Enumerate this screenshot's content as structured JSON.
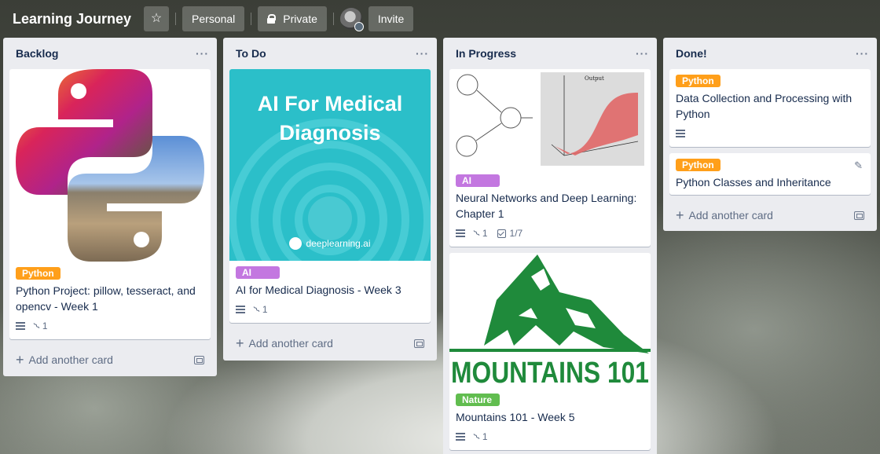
{
  "board": {
    "title": "Learning Journey",
    "visibility_team": "Personal",
    "visibility": "Private",
    "invite_label": "Invite"
  },
  "colors": {
    "python": "#ff9f1a",
    "ai": "#c377e0",
    "nature": "#61bd4f"
  },
  "lists": [
    {
      "title": "Backlog",
      "add_label": "Add another card",
      "cards": [
        {
          "cover": "python-logo-collage",
          "label": "Python",
          "title": "Python Project: pillow, tesseract, and opencv - Week 1",
          "attachments": "1"
        }
      ]
    },
    {
      "title": "To Do",
      "add_label": "Add another card",
      "cards": [
        {
          "cover_title": "AI For Medical Diagnosis",
          "cover_brand": "deeplearning.ai",
          "label": "AI",
          "title": "AI for Medical Diagnosis - Week 3",
          "attachments": "1"
        }
      ]
    },
    {
      "title": "In Progress",
      "add_label": "",
      "cards": [
        {
          "cover": "neural-net-diagram",
          "cover_plot_title": "Output",
          "label": "AI",
          "title": "Neural Networks and Deep Learning: Chapter 1",
          "attachments": "1",
          "checklist": "1/7"
        },
        {
          "cover_text": "MOUNTAINS 101",
          "label": "Nature",
          "title": "Mountains 101 - Week 5",
          "attachments": "1"
        }
      ]
    },
    {
      "title": "Done!",
      "add_label": "Add another card",
      "cards": [
        {
          "label": "Python",
          "title": "Data Collection and Processing with Python"
        },
        {
          "label": "Python",
          "title": "Python Classes and Inheritance"
        }
      ]
    }
  ]
}
